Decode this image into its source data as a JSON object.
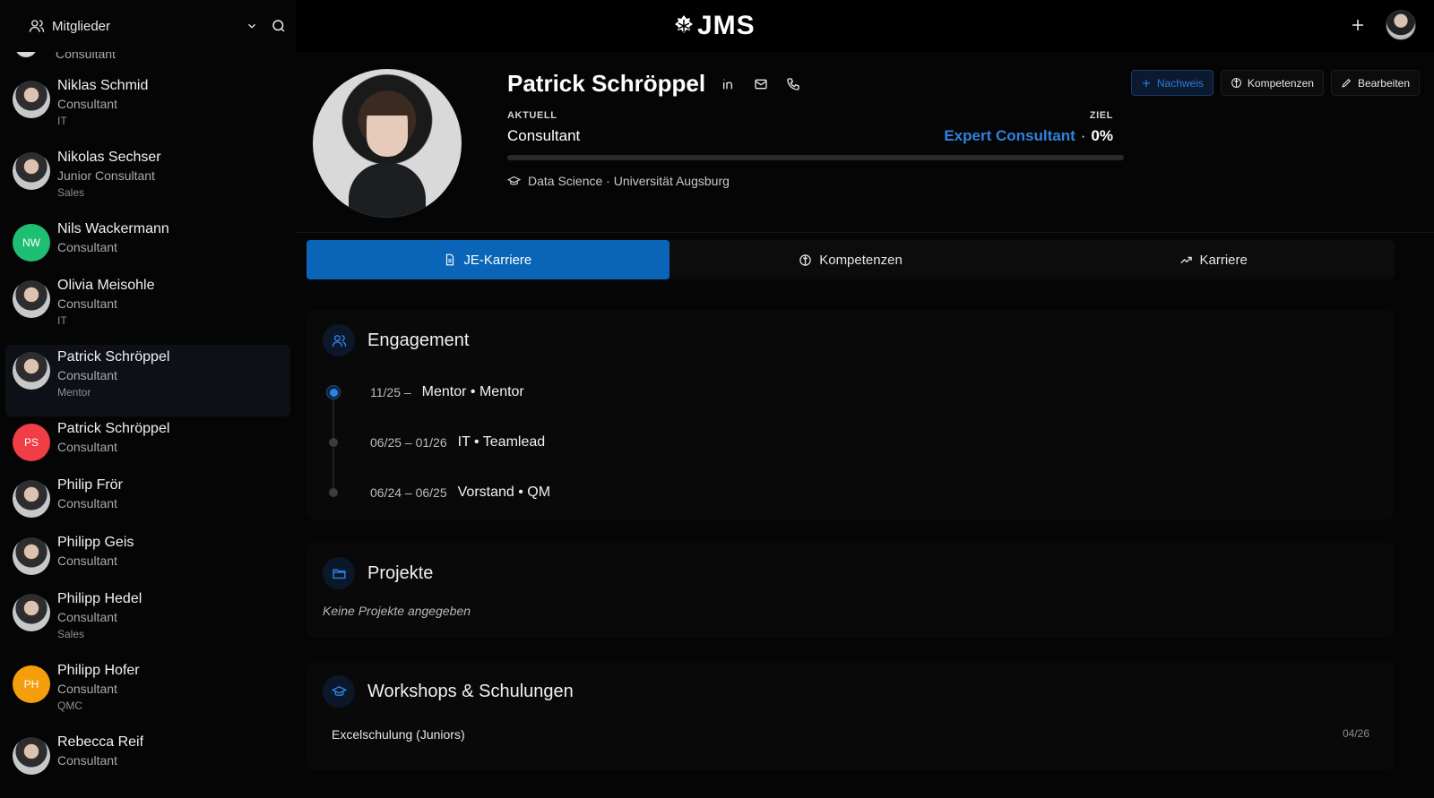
{
  "header": {
    "members_label": "Mitglieder",
    "logo_text": "JMS"
  },
  "sidebar": {
    "partial_top_role": "Consultant",
    "members": [
      {
        "name": "Niklas Schmid",
        "role": "Consultant",
        "dept": "IT",
        "avatar": "photo"
      },
      {
        "name": "Nikolas Sechser",
        "role": "Junior Consultant",
        "dept": "Sales",
        "avatar": "photo"
      },
      {
        "name": "Nils Wackermann",
        "role": "Consultant",
        "dept": "",
        "initials": "NW",
        "color": "#1fbf73"
      },
      {
        "name": "Olivia Meisohle",
        "role": "Consultant",
        "dept": "IT",
        "avatar": "photo"
      },
      {
        "name": "Patrick Schröppel",
        "role": "Consultant",
        "dept": "Mentor",
        "avatar": "photo",
        "active": true
      },
      {
        "name": "Patrick Schröppel",
        "role": "Consultant",
        "dept": "",
        "initials": "PS",
        "color": "#ef3e46"
      },
      {
        "name": "Philip Frör",
        "role": "Consultant",
        "dept": "",
        "avatar": "photo"
      },
      {
        "name": "Philipp Geis",
        "role": "Consultant",
        "dept": "",
        "avatar": "photo"
      },
      {
        "name": "Philipp Hedel",
        "role": "Consultant",
        "dept": "Sales",
        "avatar": "photo"
      },
      {
        "name": "Philipp Hofer",
        "role": "Consultant",
        "dept": "QMC",
        "initials": "PH",
        "color": "#f59e0b"
      },
      {
        "name": "Rebecca Reif",
        "role": "Consultant",
        "dept": "",
        "avatar": "photo"
      }
    ]
  },
  "profile": {
    "name": "Patrick Schröppel",
    "current_label": "AKTUELL",
    "current_value": "Consultant",
    "goal_label": "ZIEL",
    "goal_value": "Expert Consultant",
    "goal_sep": "·",
    "goal_progress": "0%",
    "progress_fraction": 0,
    "education": "Data Science · Universität Augsburg"
  },
  "actions": {
    "nachweis": "Nachweis",
    "kompetenzen": "Kompetenzen",
    "bearbeiten": "Bearbeiten"
  },
  "tabs": [
    {
      "label": "JE-Karriere",
      "active": true
    },
    {
      "label": "Kompetenzen"
    },
    {
      "label": "Karriere"
    }
  ],
  "engagement": {
    "title": "Engagement",
    "items": [
      {
        "date": "11/25 –",
        "title": "Mentor • Mentor",
        "current": true
      },
      {
        "date": "06/25 – 01/26",
        "title": "IT • Teamlead"
      },
      {
        "date": "06/24 – 06/25",
        "title": "Vorstand • QM"
      }
    ]
  },
  "projects": {
    "title": "Projekte",
    "empty": "Keine Projekte angegeben"
  },
  "workshops": {
    "title": "Workshops & Schulungen",
    "items": [
      {
        "name": "Excelschulung (Juniors)",
        "date": "04/26"
      }
    ]
  },
  "colors": {
    "accent": "#0a64b8",
    "accent_text": "#2f82e0"
  }
}
